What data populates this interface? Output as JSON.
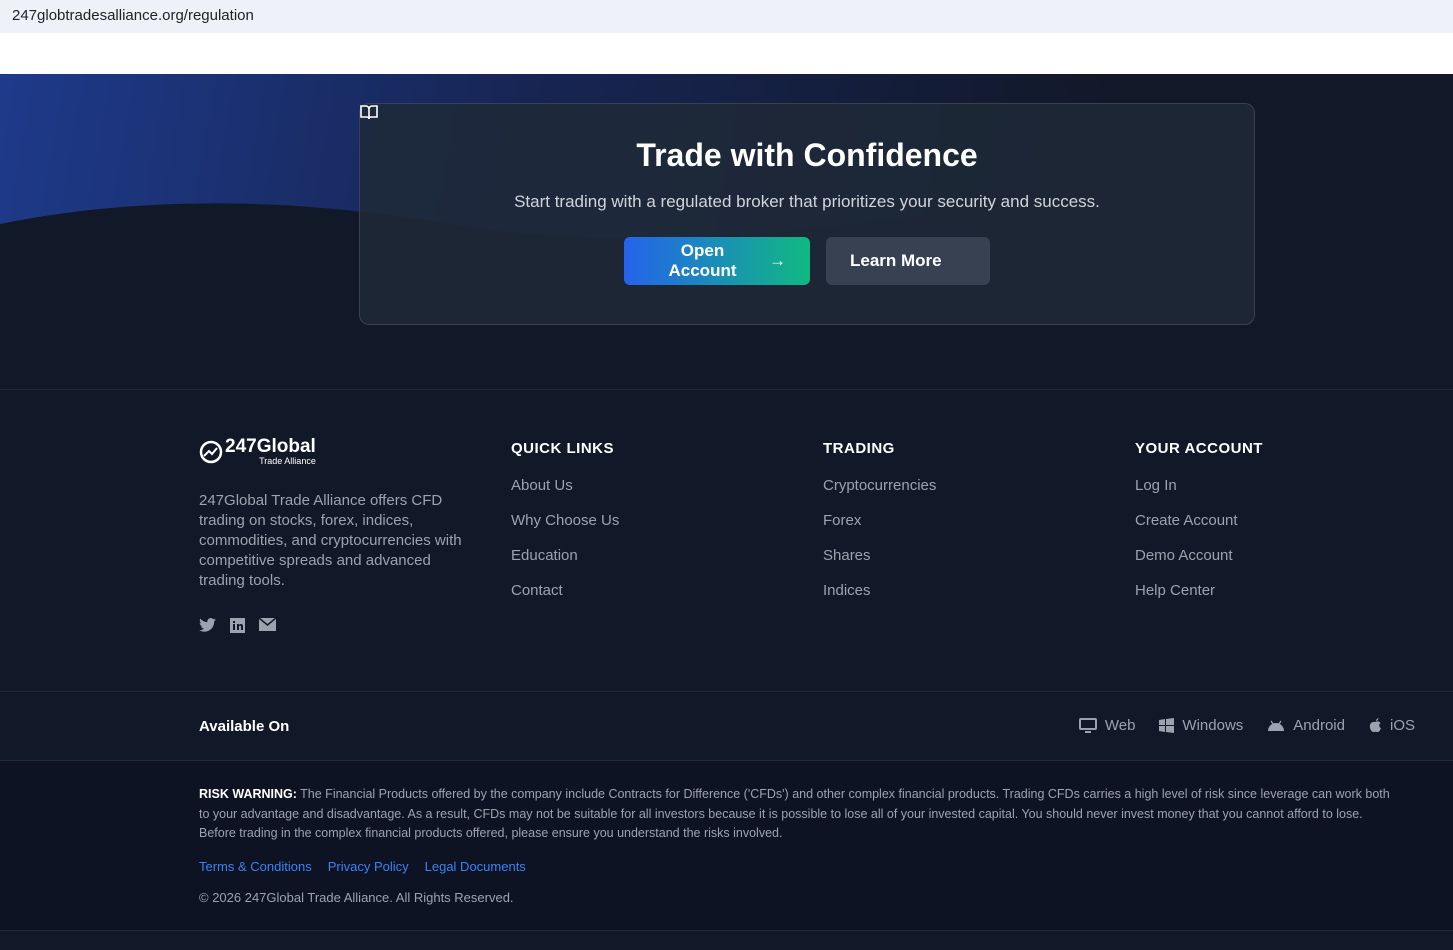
{
  "browser": {
    "url": "247globtradesalliance.org/regulation"
  },
  "cta": {
    "title": "Trade with Confidence",
    "subtitle": "Start trading with a regulated broker that prioritizes your security and success.",
    "open_account": "Open Account",
    "learn_more": "Learn More"
  },
  "footer": {
    "logo": {
      "main": "247Global",
      "sub": "Trade Alliance"
    },
    "description": "247Global Trade Alliance offers CFD trading on stocks, forex, indices, commodities, and cryptocurrencies with competitive spreads and advanced trading tools.",
    "columns": [
      {
        "title": "QUICK LINKS",
        "links": [
          "About Us",
          "Why Choose Us",
          "Education",
          "Contact"
        ]
      },
      {
        "title": "TRADING",
        "links": [
          "Cryptocurrencies",
          "Forex",
          "Shares",
          "Indices"
        ]
      },
      {
        "title": "YOUR ACCOUNT",
        "links": [
          "Log In",
          "Create Account",
          "Demo Account",
          "Help Center"
        ]
      }
    ],
    "available_on": "Available On",
    "platforms": [
      "Web",
      "Windows",
      "Android",
      "iOS"
    ],
    "risk_label": "RISK WARNING:",
    "risk_text": " The Financial Products offered by the company include Contracts for Difference ('CFDs') and other complex financial products. Trading CFDs carries a high level of risk since leverage can work both to your advantage and disadvantage. As a result, CFDs may not be suitable for all investors because it is possible to lose all of your invested capital. You should never invest money that you cannot afford to lose. Before trading in the complex financial products offered, please ensure you understand the risks involved.",
    "legal_links": [
      "Terms & Conditions",
      "Privacy Policy",
      "Legal Documents"
    ],
    "copyright": "© 2026 247Global Trade Alliance. All Rights Reserved."
  }
}
